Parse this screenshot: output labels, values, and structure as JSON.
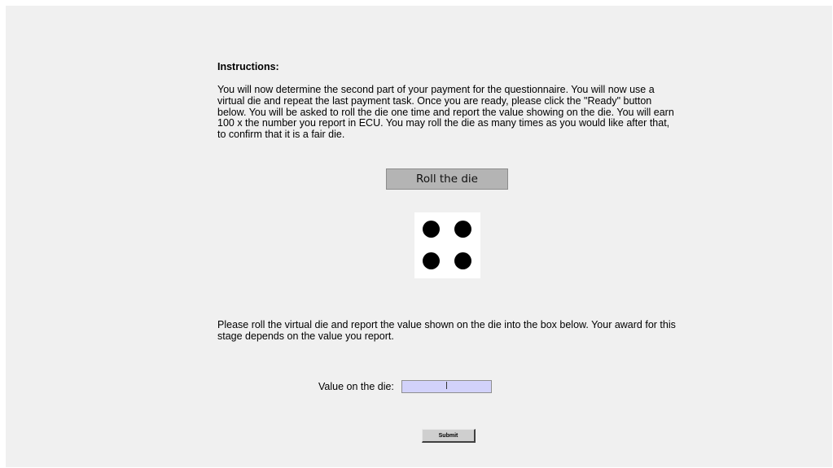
{
  "instructions": {
    "heading": "Instructions:",
    "body": "You will now determine the second part of your payment for the questionnaire. You will now use a virtual die and repeat the last payment task.  Once you are ready, please click the \"Ready\" button below. You will be asked to roll the die one time and report the value showing on the die. You will earn 100 x the number you report in ECU. You may roll the die as many times as you would like after that, to confirm that it is a fair die."
  },
  "roll_button": {
    "label": "Roll the die"
  },
  "die": {
    "value": 4,
    "face_color": "#ffffff",
    "pip_color": "#000000"
  },
  "report": {
    "text": "Please roll the virtual die and report the value shown on the die into the box below. Your award for this stage depends on the value you report."
  },
  "value_field": {
    "label": "Value on the die:",
    "value": "",
    "background": "#d2d2fa"
  },
  "submit_button": {
    "label": "Submit"
  }
}
